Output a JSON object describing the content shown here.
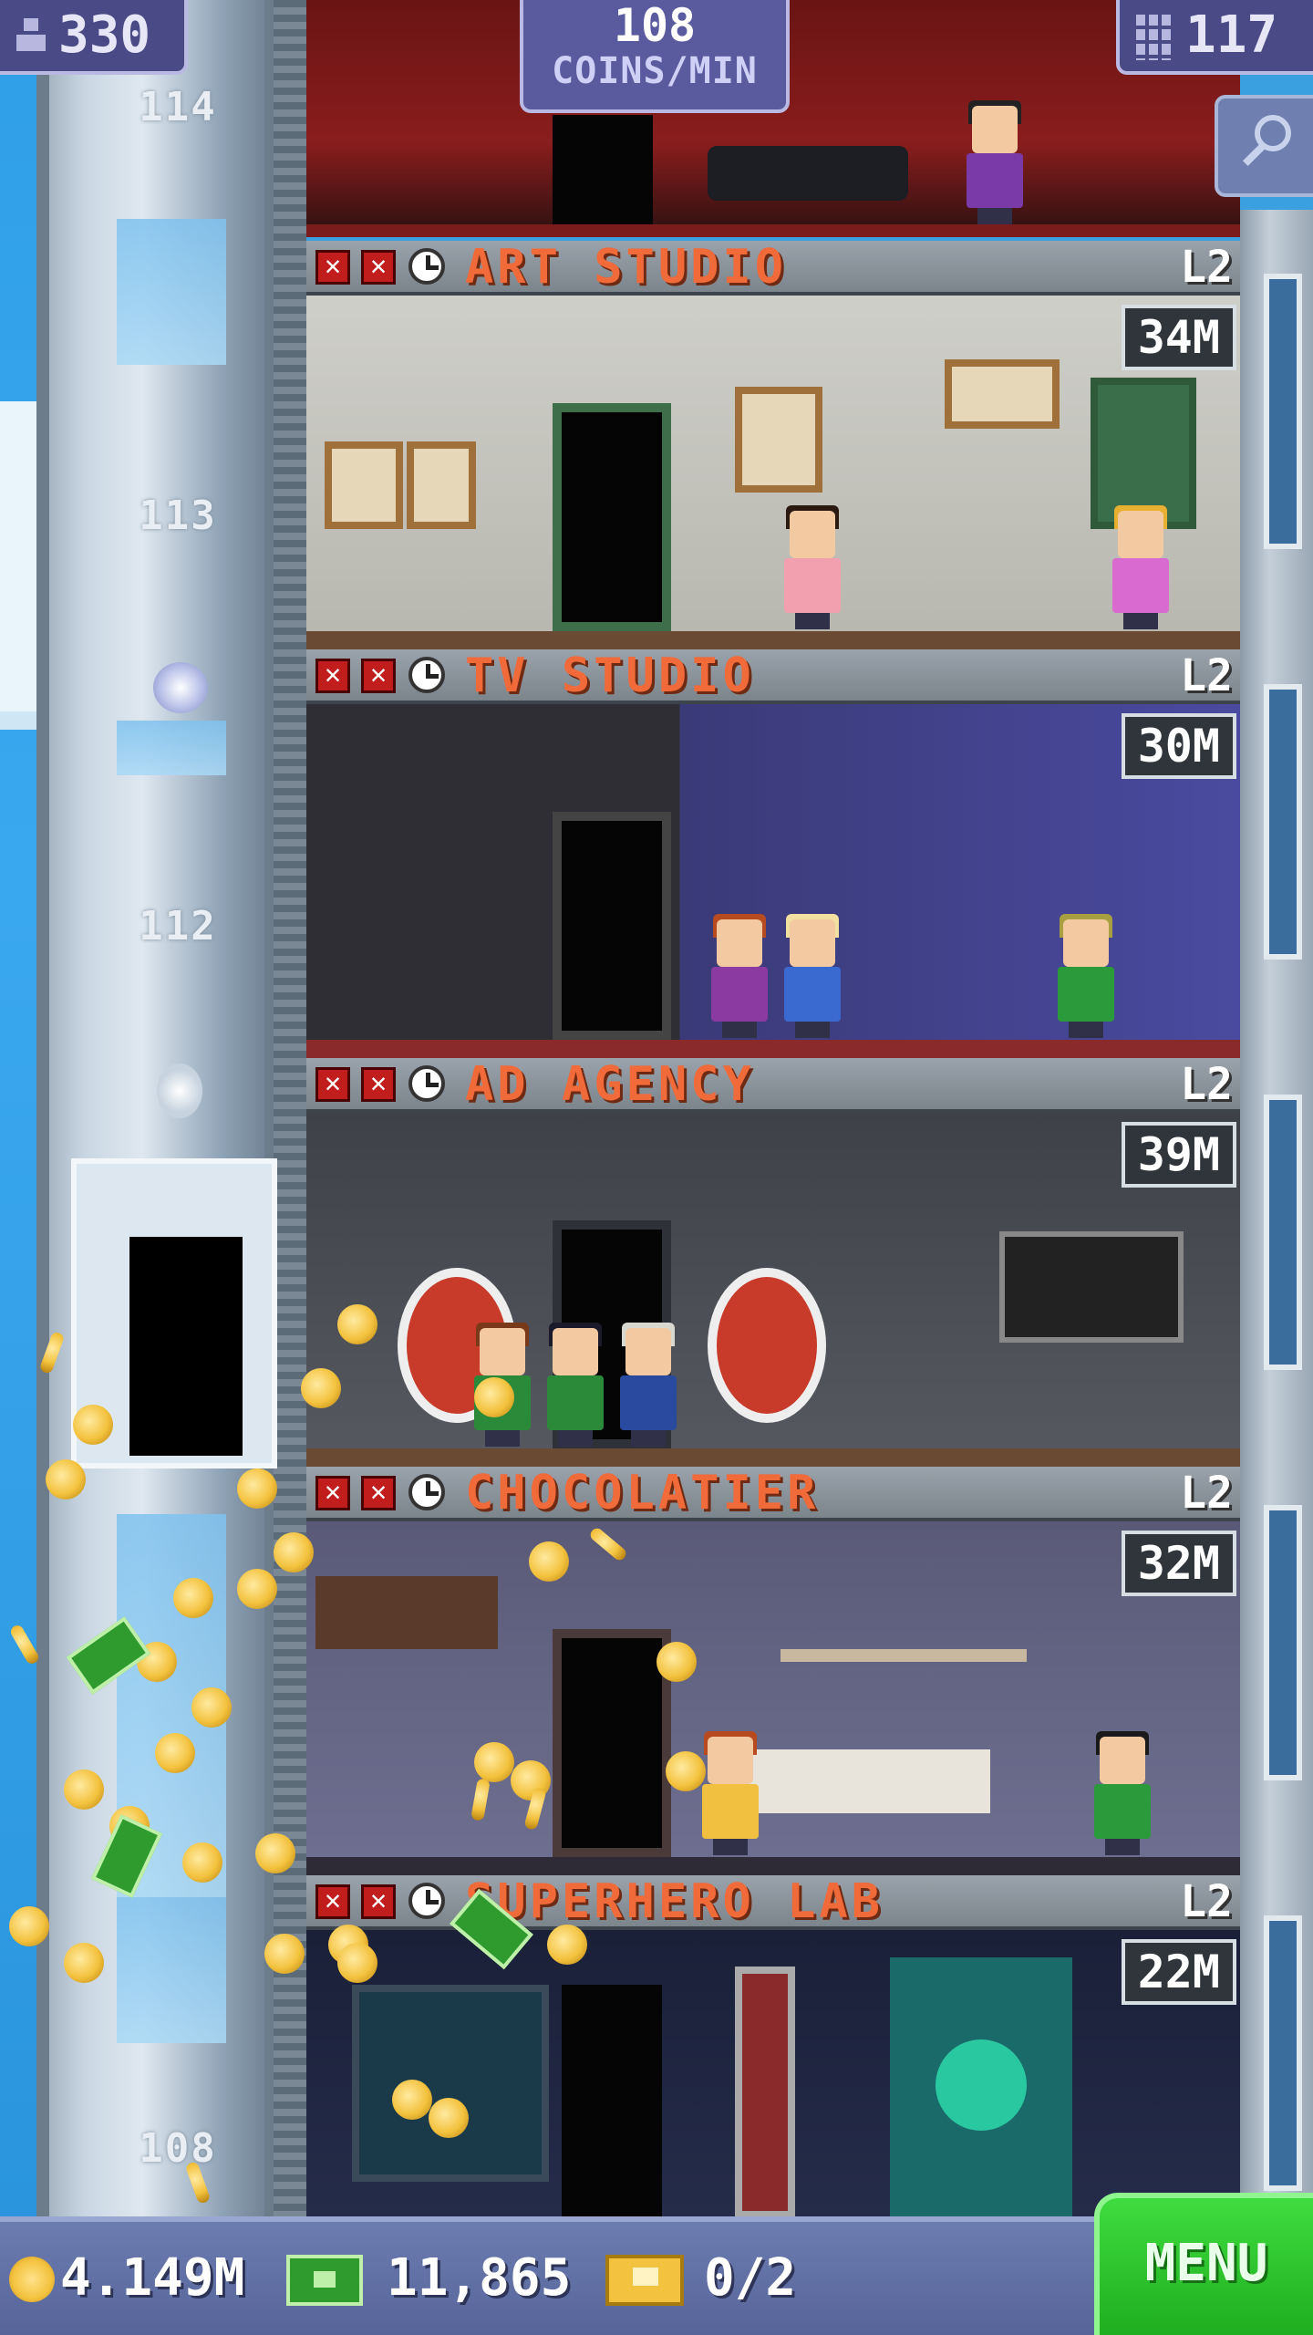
{
  "hud": {
    "population": "330",
    "coins_per_min_value": "108",
    "coins_per_min_label": "COINS/MIN",
    "floors_count": "117"
  },
  "shaft": {
    "floor_numbers": [
      "114",
      "113",
      "112",
      "108"
    ]
  },
  "floors": [
    {
      "name": "ART STUDIO",
      "level": "L2",
      "value": "34M"
    },
    {
      "name": "TV STUDIO",
      "level": "L2",
      "value": "30M"
    },
    {
      "name": "AD AGENCY",
      "level": "L2",
      "value": "39M"
    },
    {
      "name": "CHOCOLATIER",
      "level": "L2",
      "value": "32M"
    },
    {
      "name": "SUPERHERO LAB",
      "level": "L2",
      "value": "22M"
    }
  ],
  "bottom": {
    "coins": "4.149M",
    "bux": "11,865",
    "tickets": "0/2",
    "menu_label": "MENU"
  },
  "colors": {
    "floor_name": "#f06a3a",
    "hud_bg": "#4a4a86",
    "menu_green": "#2fc92f",
    "bottom_bar": "#6c7cb0"
  },
  "icons": [
    "population-icon",
    "floors-icon",
    "search-icon",
    "coin-icon",
    "bux-icon",
    "ticket-icon",
    "clock-icon",
    "stock-x-icon"
  ]
}
